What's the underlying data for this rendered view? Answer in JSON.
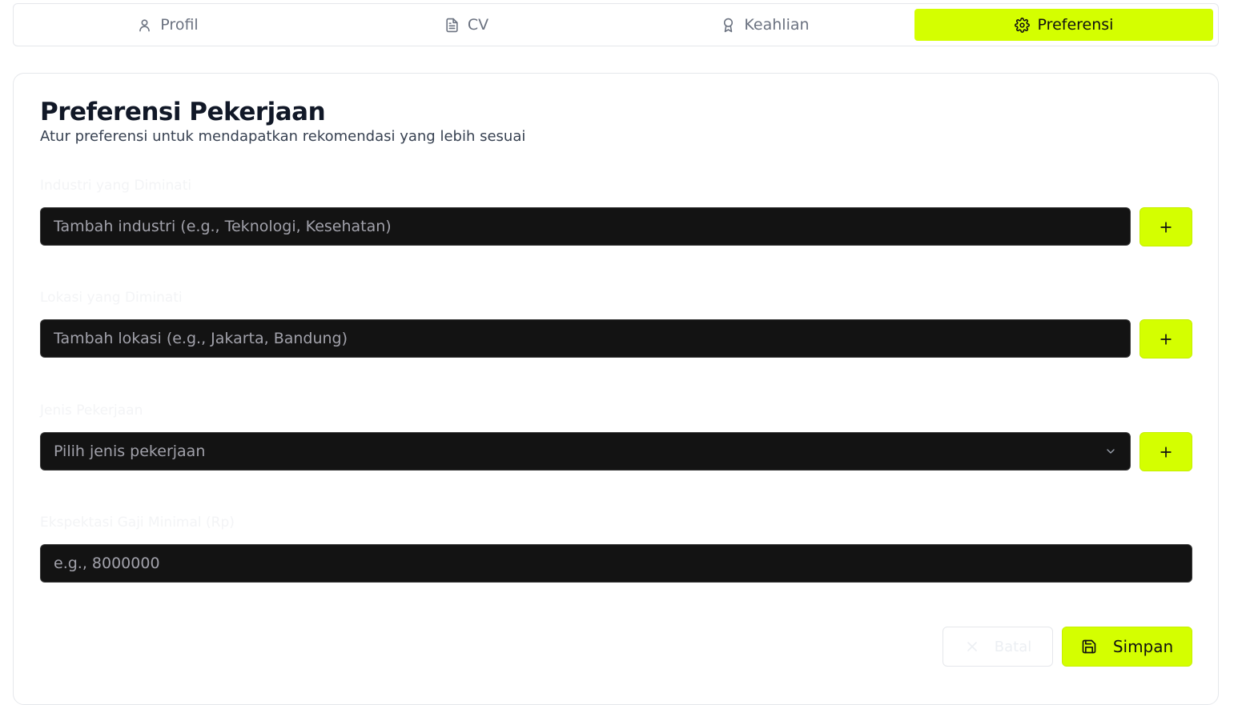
{
  "tabs": [
    {
      "label": "Profil",
      "icon": "user-icon",
      "active": false
    },
    {
      "label": "CV",
      "icon": "file-text-icon",
      "active": false
    },
    {
      "label": "Keahlian",
      "icon": "award-icon",
      "active": false
    },
    {
      "label": "Preferensi",
      "icon": "gear-icon",
      "active": true
    }
  ],
  "card": {
    "title": "Preferensi Pekerjaan",
    "subtitle": "Atur preferensi untuk mendapatkan rekomendasi yang lebih sesuai"
  },
  "fields": {
    "industry": {
      "label": "Industri yang Diminati",
      "placeholder": "Tambah industri (e.g., Teknologi, Kesehatan)"
    },
    "location": {
      "label": "Lokasi yang Diminati",
      "placeholder": "Tambah lokasi (e.g., Jakarta, Bandung)"
    },
    "job_type": {
      "label": "Jenis Pekerjaan",
      "selected": "Pilih jenis pekerjaan"
    },
    "salary": {
      "label": "Ekspektasi Gaji Minimal (Rp)",
      "placeholder": "e.g., 8000000"
    }
  },
  "actions": {
    "cancel_label": "Batal",
    "save_label": "Simpan"
  },
  "colors": {
    "accent": "#d4ff00",
    "input_bg": "#131313"
  }
}
